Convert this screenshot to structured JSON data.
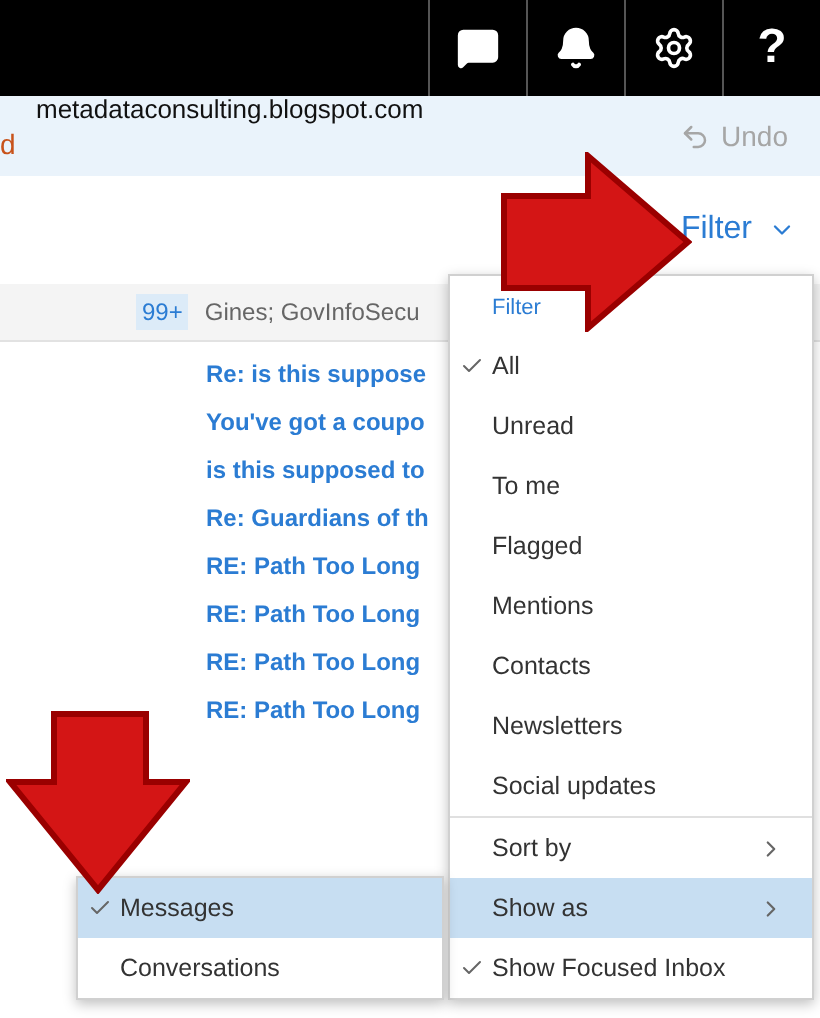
{
  "topbar": {
    "help": "?"
  },
  "notice": {
    "site": "metadataconsulting.blogspot.com",
    "fragment": "d",
    "undo": "Undo"
  },
  "filter_button": {
    "label": "Filter",
    "expanded": true
  },
  "header_row": {
    "count": "99+",
    "senders": "Gines; GovInfoSecu"
  },
  "messages": [
    {
      "subject": "Re: is this suppose"
    },
    {
      "subject": "You've got a coupo"
    },
    {
      "subject": "is this supposed to"
    },
    {
      "subject": "Re: Guardians of th"
    },
    {
      "subject": "RE: Path Too Long"
    },
    {
      "subject": "RE: Path Too Long"
    },
    {
      "subject": "RE: Path Too Long"
    },
    {
      "subject": "RE: Path Too Long"
    }
  ],
  "filter_menu": {
    "heading": "Filter",
    "items": [
      {
        "kind": "option",
        "label": "All",
        "checked": true,
        "selected": false
      },
      {
        "kind": "option",
        "label": "Unread",
        "checked": false,
        "selected": false
      },
      {
        "kind": "option",
        "label": "To me",
        "checked": false,
        "selected": false
      },
      {
        "kind": "option",
        "label": "Flagged",
        "checked": false,
        "selected": false
      },
      {
        "kind": "option",
        "label": "Mentions",
        "checked": false,
        "selected": false
      },
      {
        "kind": "option",
        "label": "Contacts",
        "checked": false,
        "selected": false
      },
      {
        "kind": "option",
        "label": "Newsletters",
        "checked": false,
        "selected": false
      },
      {
        "kind": "option",
        "label": "Social updates",
        "checked": false,
        "selected": false
      },
      {
        "kind": "submenu",
        "label": "Sort by",
        "checked": false,
        "selected": false
      },
      {
        "kind": "submenu",
        "label": "Show as",
        "checked": false,
        "selected": true
      },
      {
        "kind": "option",
        "label": "Show Focused Inbox",
        "checked": true,
        "selected": false
      }
    ]
  },
  "show_as_menu": {
    "items": [
      {
        "label": "Messages",
        "checked": true,
        "selected": true
      },
      {
        "label": "Conversations",
        "checked": false,
        "selected": false
      }
    ]
  }
}
